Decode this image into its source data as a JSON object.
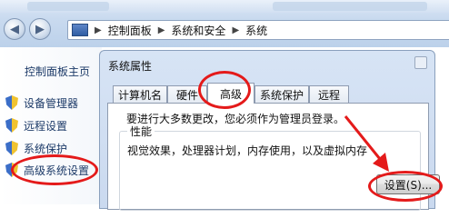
{
  "breadcrumb": [
    "控制面板",
    "系统和安全",
    "系统"
  ],
  "left_nav": {
    "home": "控制面板主页",
    "items": [
      "设备管理器",
      "远程设置",
      "系统保护",
      "高级系统设置"
    ]
  },
  "dialog": {
    "title": "系统属性",
    "tabs": [
      "计算机名",
      "硬件",
      "高级",
      "系统保护",
      "远程"
    ],
    "active_tab": "高级",
    "message": "要进行大多数更改，您必须作为管理员登录。",
    "performance": {
      "label": "性能",
      "description": "视觉效果，处理器计划，内存使用，以及虚拟内存",
      "button": "设置(S)..."
    }
  },
  "colors": {
    "highlight": "#e41a1a",
    "link": "#1c3a68"
  },
  "icons": {
    "back": "back-arrow-icon",
    "forward": "forward-arrow-icon",
    "nav_item": "shield-icon",
    "address": "control-panel-icon"
  }
}
